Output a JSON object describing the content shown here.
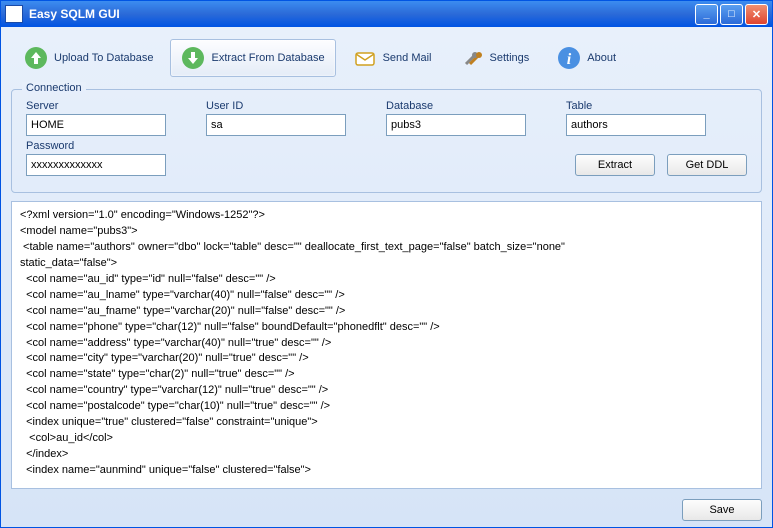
{
  "title": "Easy SQLM GUI",
  "toolbar": {
    "upload": "Upload To Database",
    "extract": "Extract From Database",
    "sendmail": "Send Mail",
    "settings": "Settings",
    "about": "About"
  },
  "connection": {
    "legend": "Connection",
    "server_label": "Server",
    "server_value": "HOME",
    "userid_label": "User ID",
    "userid_value": "sa",
    "database_label": "Database",
    "database_value": "pubs3",
    "table_label": "Table",
    "table_value": "authors",
    "password_label": "Password",
    "password_value": "xxxxxxxxxxxxx",
    "extract_btn": "Extract",
    "getddl_btn": "Get DDL"
  },
  "output_text": "<?xml version=\"1.0\" encoding=\"Windows-1252\"?>\n<model name=\"pubs3\">\n <table name=\"authors\" owner=\"dbo\" lock=\"table\" desc=\"\" deallocate_first_text_page=\"false\" batch_size=\"none\"\nstatic_data=\"false\">\n  <col name=\"au_id\" type=\"id\" null=\"false\" desc=\"\" />\n  <col name=\"au_lname\" type=\"varchar(40)\" null=\"false\" desc=\"\" />\n  <col name=\"au_fname\" type=\"varchar(20)\" null=\"false\" desc=\"\" />\n  <col name=\"phone\" type=\"char(12)\" null=\"false\" boundDefault=\"phonedflt\" desc=\"\" />\n  <col name=\"address\" type=\"varchar(40)\" null=\"true\" desc=\"\" />\n  <col name=\"city\" type=\"varchar(20)\" null=\"true\" desc=\"\" />\n  <col name=\"state\" type=\"char(2)\" null=\"true\" desc=\"\" />\n  <col name=\"country\" type=\"varchar(12)\" null=\"true\" desc=\"\" />\n  <col name=\"postalcode\" type=\"char(10)\" null=\"true\" desc=\"\" />\n  <index unique=\"true\" clustered=\"false\" constraint=\"unique\">\n   <col>au_id</col>\n  </index>\n  <index name=\"aunmind\" unique=\"false\" clustered=\"false\">",
  "footer": {
    "save_btn": "Save"
  },
  "colors": {
    "accent": "#2b6ad8"
  }
}
